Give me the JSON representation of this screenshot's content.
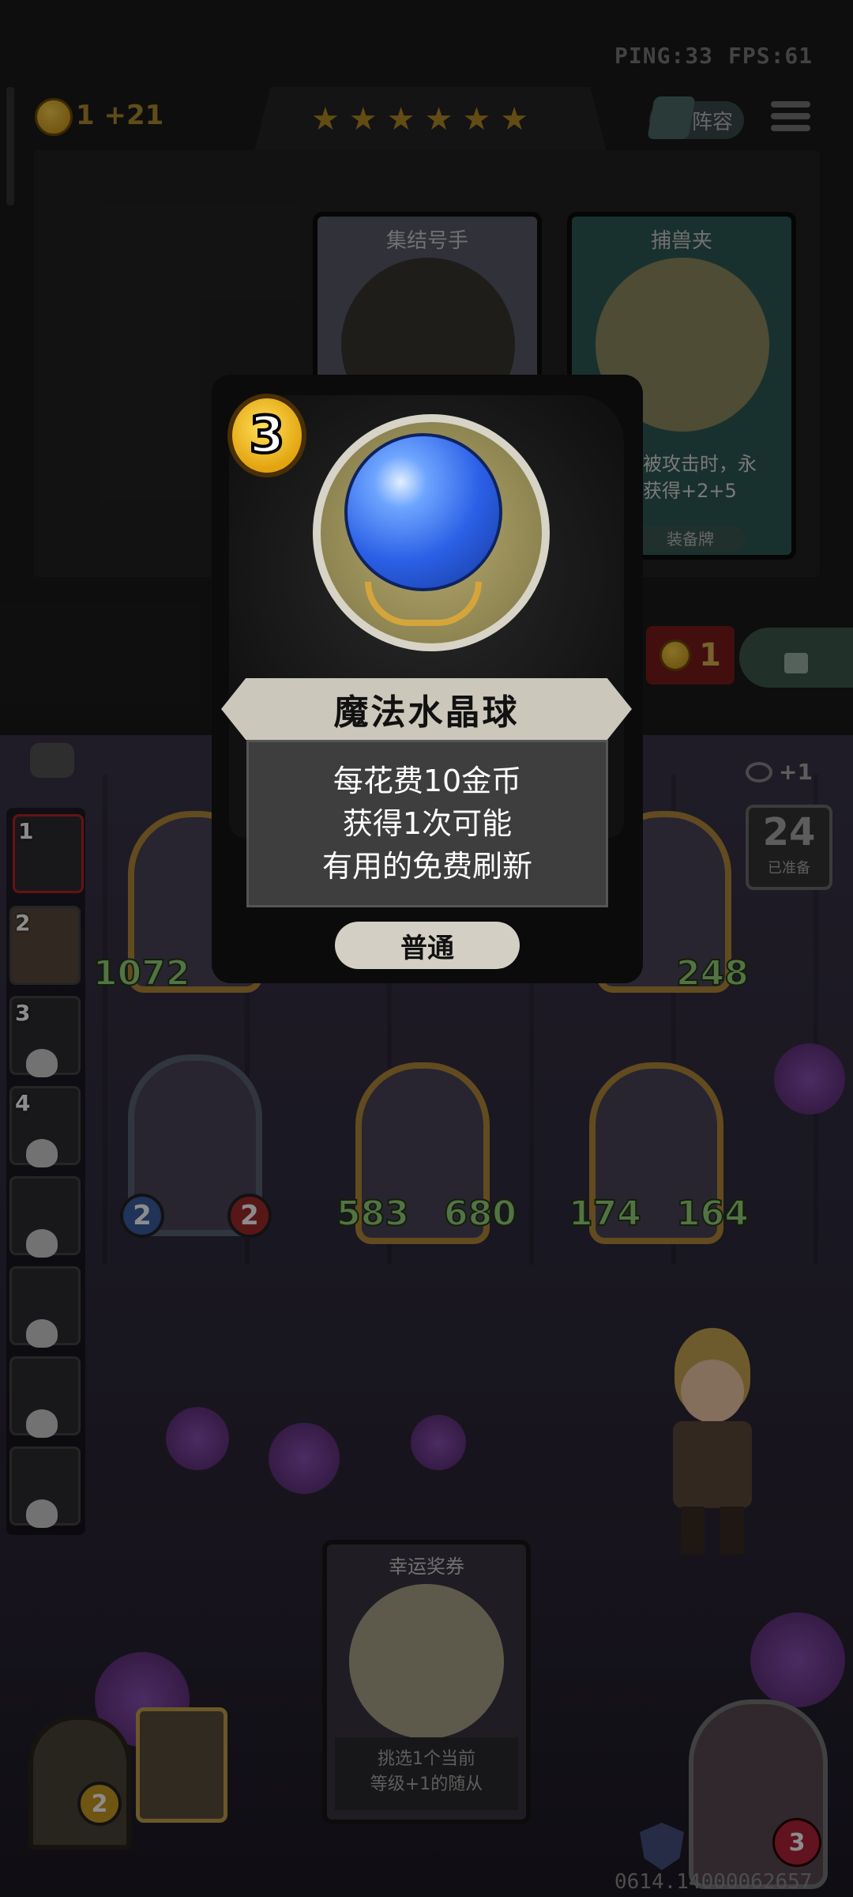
{
  "hud": {
    "ping": "PING:33",
    "fps": "FPS:61",
    "gold_delta": "1 +21",
    "stars": [
      "★",
      "★",
      "★",
      "★",
      "★",
      "★"
    ],
    "lineup_label": "阵容",
    "menu_icon": "hamburger-menu-icon"
  },
  "shop": {
    "cards": [
      {
        "name": "集结号手"
      },
      {
        "name": "捕兽夹",
        "text_line1": "被攻击时，永",
        "text_line2": "获得+2+5",
        "type_label": "装备牌"
      }
    ],
    "price_value": "1",
    "lock_icon": "lock-icon"
  },
  "popup_card": {
    "cost": "3",
    "name": "魔法水晶球",
    "description": [
      "每花费10金币",
      "获得1次可能",
      "有用的免费刷新"
    ],
    "rarity": "普通"
  },
  "sidebar": {
    "slots": [
      {
        "num": "1"
      },
      {
        "num": "2"
      },
      {
        "num": "3"
      },
      {
        "num": "4"
      },
      {
        "num": ""
      },
      {
        "num": ""
      },
      {
        "num": ""
      },
      {
        "num": ""
      }
    ]
  },
  "counter": {
    "eye_plus": "+1",
    "value": "24",
    "label": "已准备"
  },
  "board": {
    "row1": [
      {
        "attack": "1072",
        "health": ""
      },
      {
        "attack": "",
        "health": "248"
      }
    ],
    "row2": [
      {
        "attack": "2",
        "health": "2"
      },
      {
        "attack": "583",
        "health": "680"
      },
      {
        "attack": "174",
        "health": "164"
      }
    ]
  },
  "bottom": {
    "lucky_title": "幸运奖券",
    "lucky_desc_line1": "挑选1个当前",
    "lucky_desc_line2": "等级+1的随从",
    "tavern_level": "2",
    "hero_health": "3",
    "game_id": "0614.14000062657"
  },
  "colors": {
    "gold": "#e2a40f",
    "stat_green": "#9ad27f",
    "orb_blue": "#2b5fe6",
    "dim_overlay": "rgba(0,0,0,0.45)"
  }
}
